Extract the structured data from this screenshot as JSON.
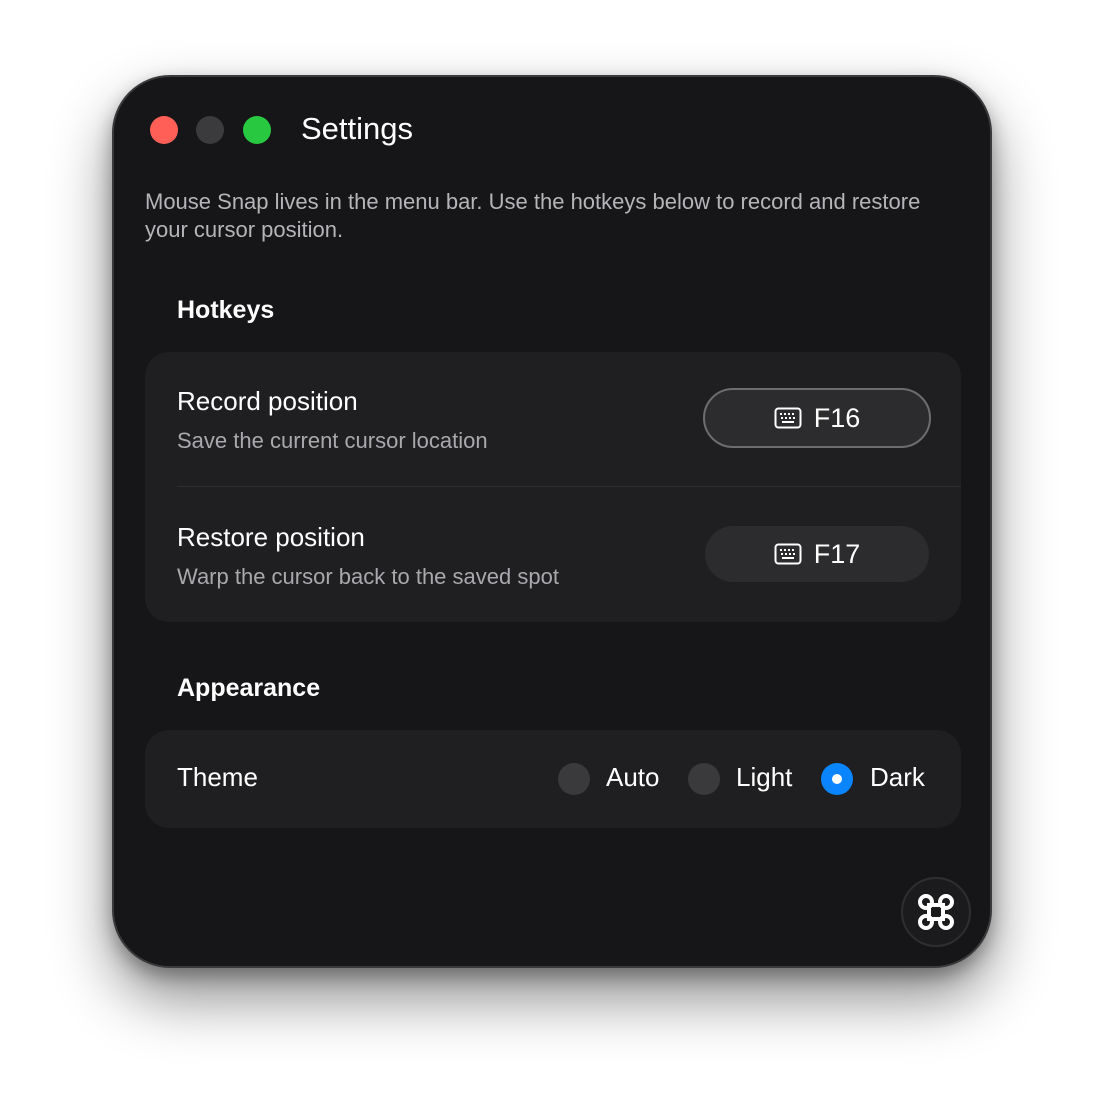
{
  "window": {
    "title": "Settings",
    "intro": "Mouse Snap lives in the menu bar. Use the hotkeys below to record and restore your cursor position."
  },
  "hotkeys": {
    "heading": "Hotkeys",
    "rows": [
      {
        "title": "Record position",
        "subtitle": "Save the current cursor location",
        "key": "F16",
        "icon": "keyboard-icon"
      },
      {
        "title": "Restore position",
        "subtitle": "Warp the cursor back to the saved spot",
        "key": "F17",
        "icon": "keyboard-icon"
      }
    ]
  },
  "appearance": {
    "heading": "Appearance",
    "theme_label": "Theme",
    "options": [
      {
        "label": "Auto",
        "selected": false
      },
      {
        "label": "Light",
        "selected": false
      },
      {
        "label": "Dark",
        "selected": true
      }
    ]
  },
  "colors": {
    "close": "#ff5f57",
    "minimize": "#3b3b3d",
    "maximize": "#28c840",
    "accent": "#0a84ff",
    "window_bg": "#161618",
    "card_bg": "#1f1f21"
  },
  "fab": {
    "icon": "command-key-icon"
  }
}
